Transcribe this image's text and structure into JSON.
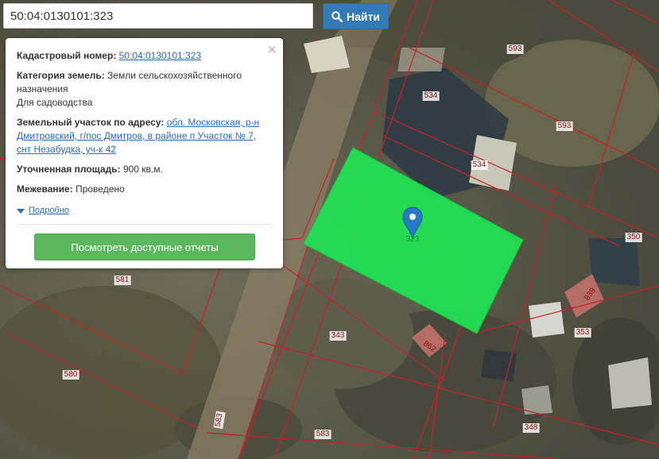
{
  "search": {
    "value": "50:04:0130101:323",
    "button_label": "Найти",
    "icon": "search-icon"
  },
  "card": {
    "cadastral_label": "Кадастровый номер:",
    "cadastral_value": "50:04:0130101:323",
    "category_label": "Категория земель:",
    "category_value": "Земли сельскохозяйственного назначения",
    "category_use": "Для садоводства",
    "address_label": "Земельный участок по адресу:",
    "address_value": "обл. Московская, р-н Дмитровский, г/пос Дмитров, в районе п Участок № 7, снт Незабудка, уч-к 42",
    "area_label": "Уточненная площадь:",
    "area_value": "900 кв.м.",
    "survey_label": "Межевание:",
    "survey_value": "Проведено",
    "details_label": "Подробно",
    "reports_button": "Посмотреть доступные отчеты",
    "close_icon": "close-icon"
  },
  "map": {
    "selected_parcel_label": "323",
    "parcel_labels": [
      "593",
      "534",
      "593",
      "534",
      "350",
      "839",
      "353",
      "862",
      "343",
      "581",
      "580",
      "583",
      "583",
      "348"
    ],
    "colors": {
      "selected_fill": "#1ee854",
      "boundary": "#c8202a",
      "marker": "#2a79c6"
    }
  }
}
